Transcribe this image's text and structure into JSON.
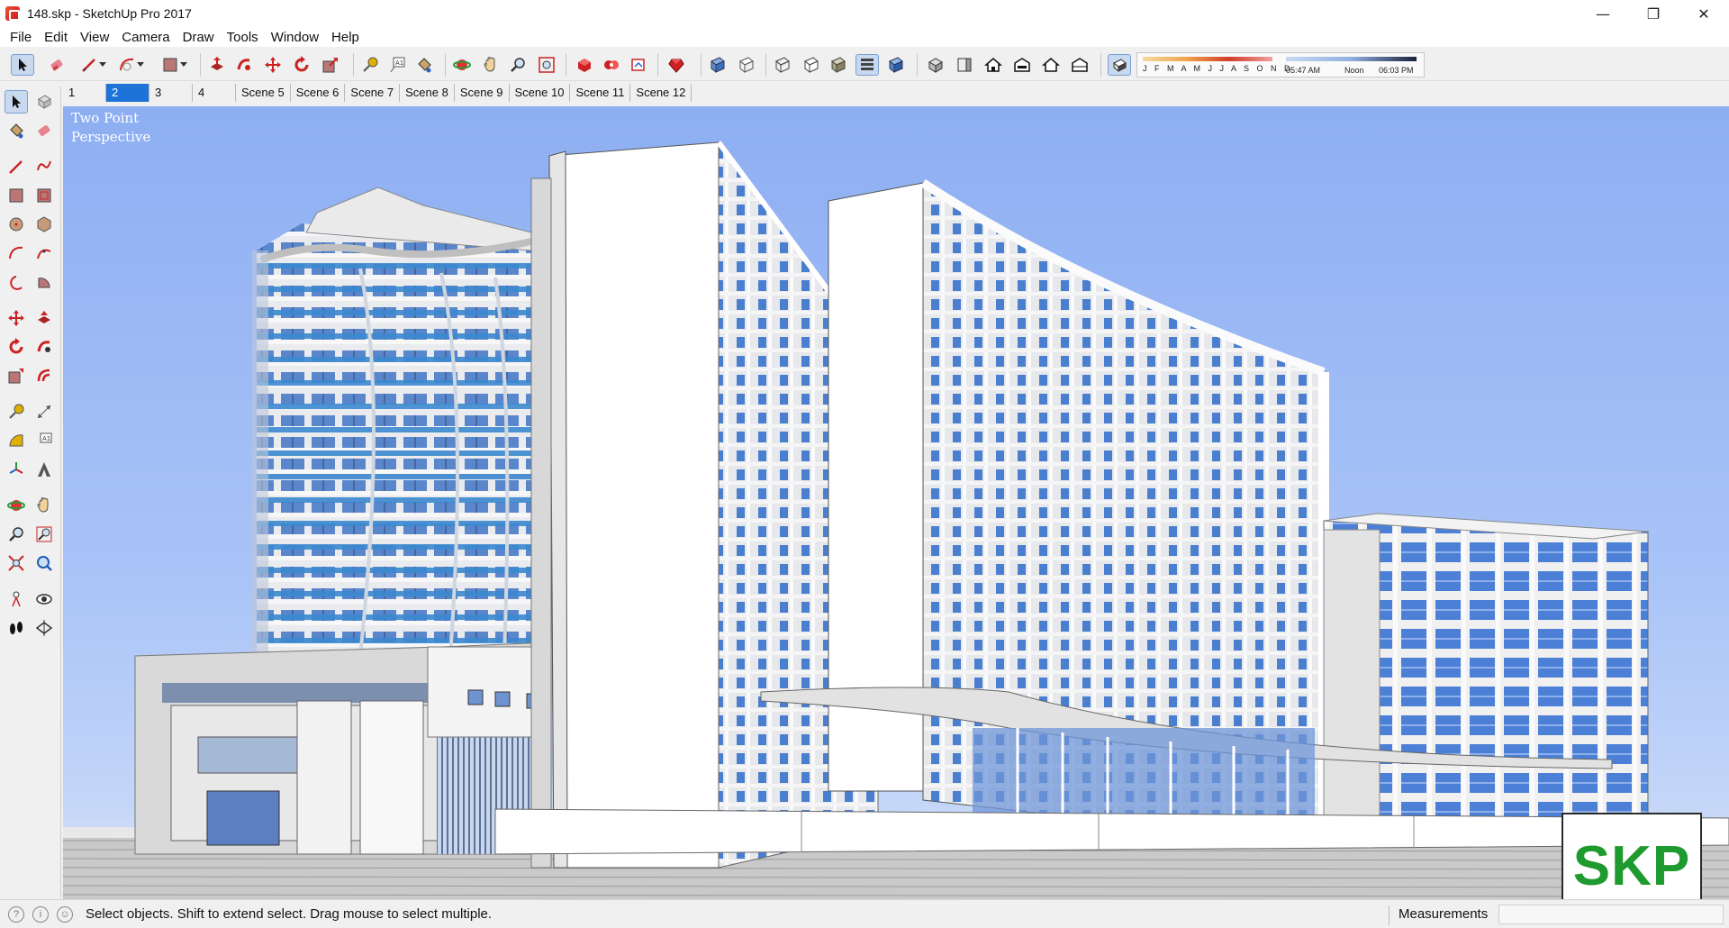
{
  "window": {
    "title": "148.skp - SketchUp Pro 2017",
    "controls": [
      "—",
      "❐",
      "✕"
    ]
  },
  "menu": [
    "File",
    "Edit",
    "View",
    "Camera",
    "Draw",
    "Tools",
    "Window",
    "Help"
  ],
  "shadow_settings": {
    "months": "J F M A M J J A S O N D",
    "time_start": "05:47 AM",
    "time_noon": "Noon",
    "time_end": "06:03 PM"
  },
  "scenes": {
    "tabs": [
      "1",
      "2",
      "3",
      "4",
      "Scene 5",
      "Scene 6",
      "Scene 7",
      "Scene 8",
      "Scene 9",
      "Scene 10",
      "Scene 11",
      "Scene 12"
    ],
    "active": "2"
  },
  "viewport": {
    "camera_label": "Two Point\nPerspective"
  },
  "status": {
    "hint": "Select objects. Shift to extend select. Drag mouse to select multiple.",
    "measurements_label": "Measurements",
    "measurements_value": ""
  },
  "logo": {
    "text": "SKP",
    "color": "#1f9a2f"
  },
  "icons": {
    "top_toolbar": [
      "select-icon",
      "eraser-icon",
      "line-icon",
      "arc-icon",
      "rectangle-icon",
      "push-pull-icon",
      "follow-me-icon",
      "move-icon",
      "rotate-icon",
      "scale-icon",
      "tape-measure-icon",
      "text-icon",
      "paint-bucket-icon",
      "orbit-icon",
      "pan-icon",
      "zoom-icon",
      "zoom-extents-icon",
      "3d-warehouse-icon",
      "extension-warehouse-icon",
      "layout-icon",
      "ruby-icon",
      "xray-icon",
      "back-edges-icon",
      "wireframe-icon",
      "hidden-line-icon",
      "shaded-icon",
      "shaded-with-textures-icon",
      "monochrome-icon",
      "iso-view-icon",
      "top-view-icon",
      "front-view-icon",
      "right-view-icon",
      "back-view-icon",
      "left-view-icon",
      "shadows-toggle-icon"
    ],
    "left_toolbar": [
      "select-icon",
      "component-icon",
      "paint-bucket-icon",
      "eraser-icon",
      "line-icon",
      "freehand-icon",
      "rectangle-icon",
      "rotated-rectangle-icon",
      "circle-icon",
      "polygon-icon",
      "arc-icon",
      "two-point-arc-icon",
      "three-point-arc-icon",
      "pie-icon",
      "move-icon",
      "push-pull-icon",
      "rotate-icon",
      "follow-me-icon",
      "scale-icon",
      "offset-icon",
      "tape-measure-icon",
      "dimension-icon",
      "protractor-icon",
      "text-icon",
      "axes-icon",
      "3d-text-icon",
      "orbit-icon",
      "pan-icon",
      "zoom-icon",
      "zoom-window-icon",
      "zoom-extents-icon",
      "previous-view-icon",
      "position-camera-icon",
      "look-around-icon",
      "walk-icon",
      "section-plane-icon"
    ]
  },
  "colors": {
    "sky_top": "#8daef2",
    "glass_blue": "#3b78d6",
    "active_tab": "#1e73d8",
    "accent_red": "#d0231c"
  }
}
